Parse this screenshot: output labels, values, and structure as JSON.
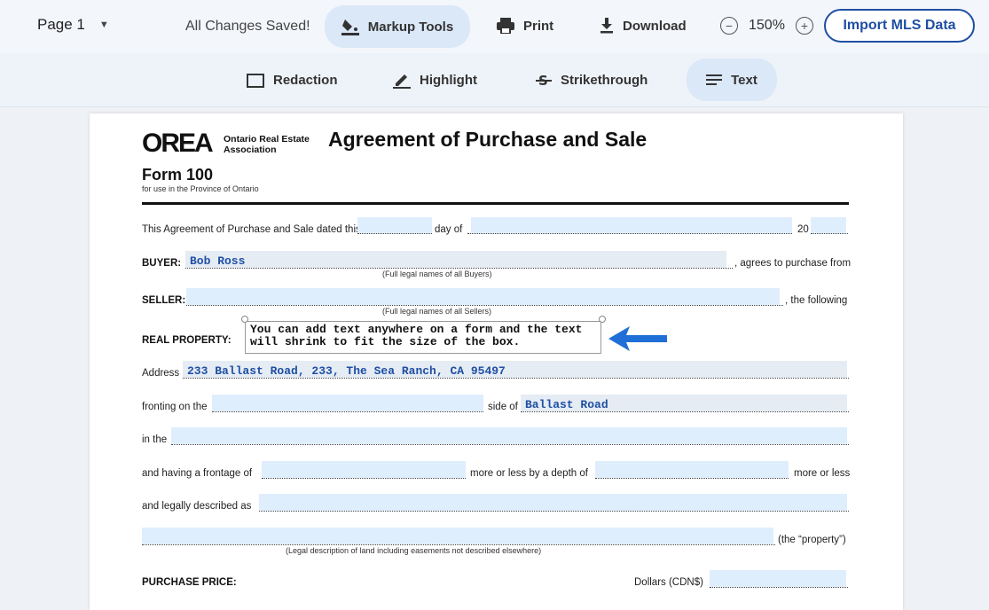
{
  "toolbar": {
    "page_label": "Page 1",
    "saved_status": "All Changes Saved!",
    "markup_tools": "Markup Tools",
    "print": "Print",
    "download": "Download",
    "zoom": "150%",
    "import_button": "Import MLS Data"
  },
  "markup_bar": {
    "redaction": "Redaction",
    "highlight": "Highlight",
    "strikethrough": "Strikethrough",
    "text": "Text"
  },
  "form": {
    "logo_text": "OREA",
    "logo_sub_line1": "Ontario Real Estate",
    "logo_sub_line2": "Association",
    "title": "Agreement of Purchase and Sale",
    "form_number": "Form 100",
    "form_sub": "for use in the Province of Ontario",
    "dated_prefix": "This Agreement of Purchase and Sale dated this",
    "day_of": "day of",
    "year_prefix": "20",
    "buyer_label": "BUYER:",
    "buyer_value": "Bob Ross",
    "buyer_suffix": ", agrees to purchase from",
    "buyer_note": "(Full legal names of all Buyers)",
    "seller_label": "SELLER:",
    "seller_suffix": ", the following",
    "seller_note": "(Full legal names of all Sellers)",
    "real_property_label": "REAL PROPERTY:",
    "text_box": "You can add text anywhere on a form and the text will shrink to fit the size of the box.",
    "address_label": "Address",
    "address_value": "233 Ballast Road, 233, The Sea Ranch, CA 95497",
    "fronting_label": "fronting on the",
    "side_of": "side of",
    "side_value": "Ballast Road",
    "in_the": "in the",
    "frontage_label": "and having a frontage of",
    "depth_label": "more or less by a depth of",
    "more_or_less": "more or less",
    "legal_label": "and legally described as",
    "property_suffix": "(the “property”)",
    "legal_note": "(Legal description of land including easements not described elsewhere)",
    "purchase_price_label": "PURCHASE PRICE:",
    "dollars_label": "Dollars (CDN$)"
  }
}
